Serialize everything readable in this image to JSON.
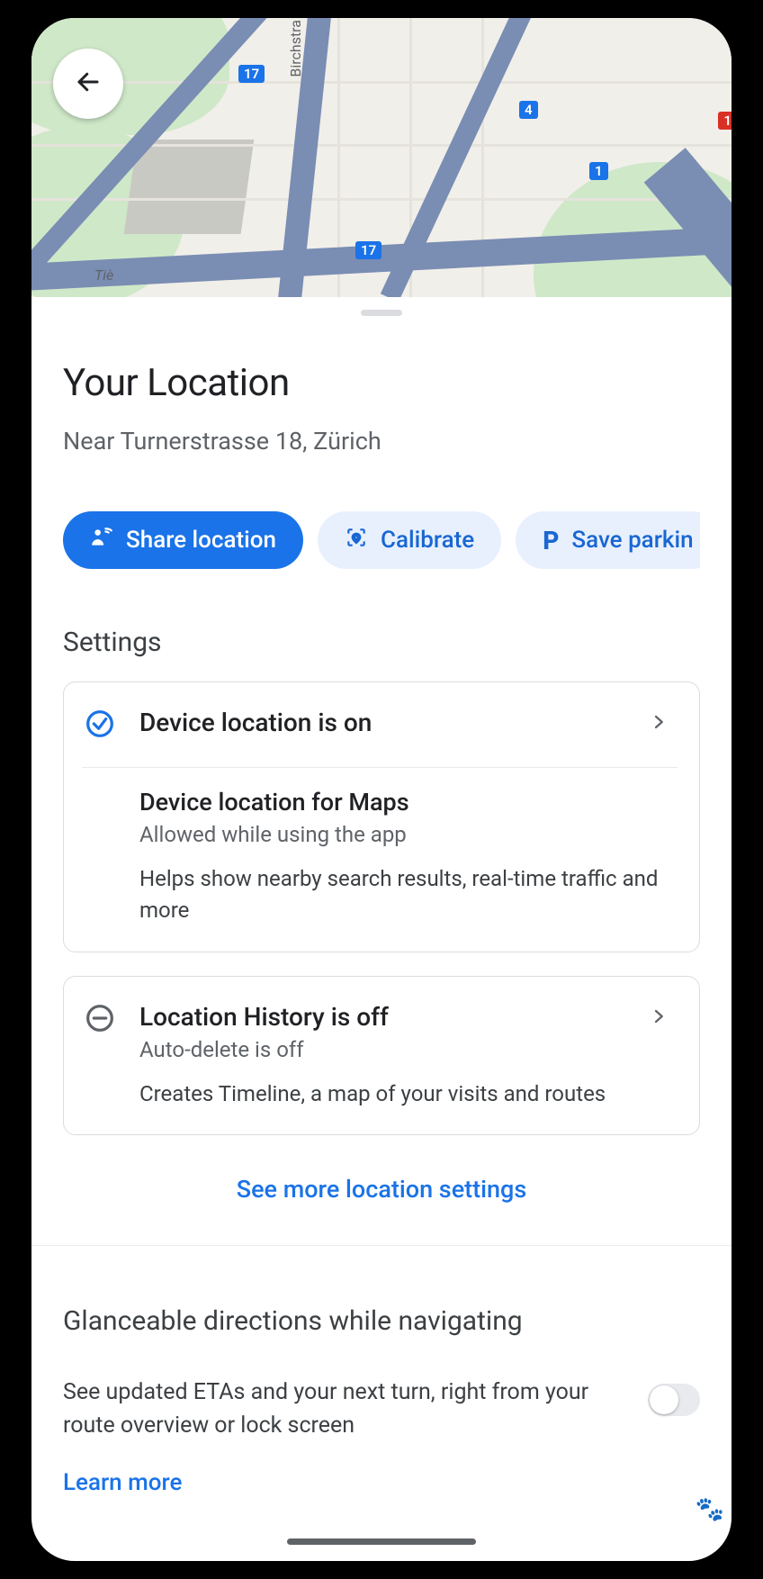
{
  "map": {
    "street_vertical": "Birchstra",
    "street_small": "Tiè",
    "shields": {
      "s1": "17",
      "s2": "4",
      "s3": "1",
      "s4": "1",
      "s5": "17"
    }
  },
  "header": {
    "title": "Your Location",
    "subtitle": "Near Turnerstrasse 18, Zürich"
  },
  "chips": {
    "share": "Share location",
    "calibrate": "Calibrate",
    "save_parking_prefix": "P",
    "save_parking": "Save parkin"
  },
  "settings": {
    "header": "Settings",
    "device_on": {
      "title": "Device location is on",
      "sub_title": "Device location for Maps",
      "sub_status": "Allowed while using the app",
      "sub_desc": "Helps show nearby search results, real-time traffic and more"
    },
    "history_off": {
      "title": "Location History is off",
      "status": "Auto-delete is off",
      "desc": "Creates Timeline, a map of your visits and routes"
    },
    "more_link": "See more location settings"
  },
  "glance": {
    "title": "Glanceable directions while navigating",
    "desc": "See updated ETAs and your next turn, right from your route overview or lock screen",
    "learn": "Learn more"
  }
}
